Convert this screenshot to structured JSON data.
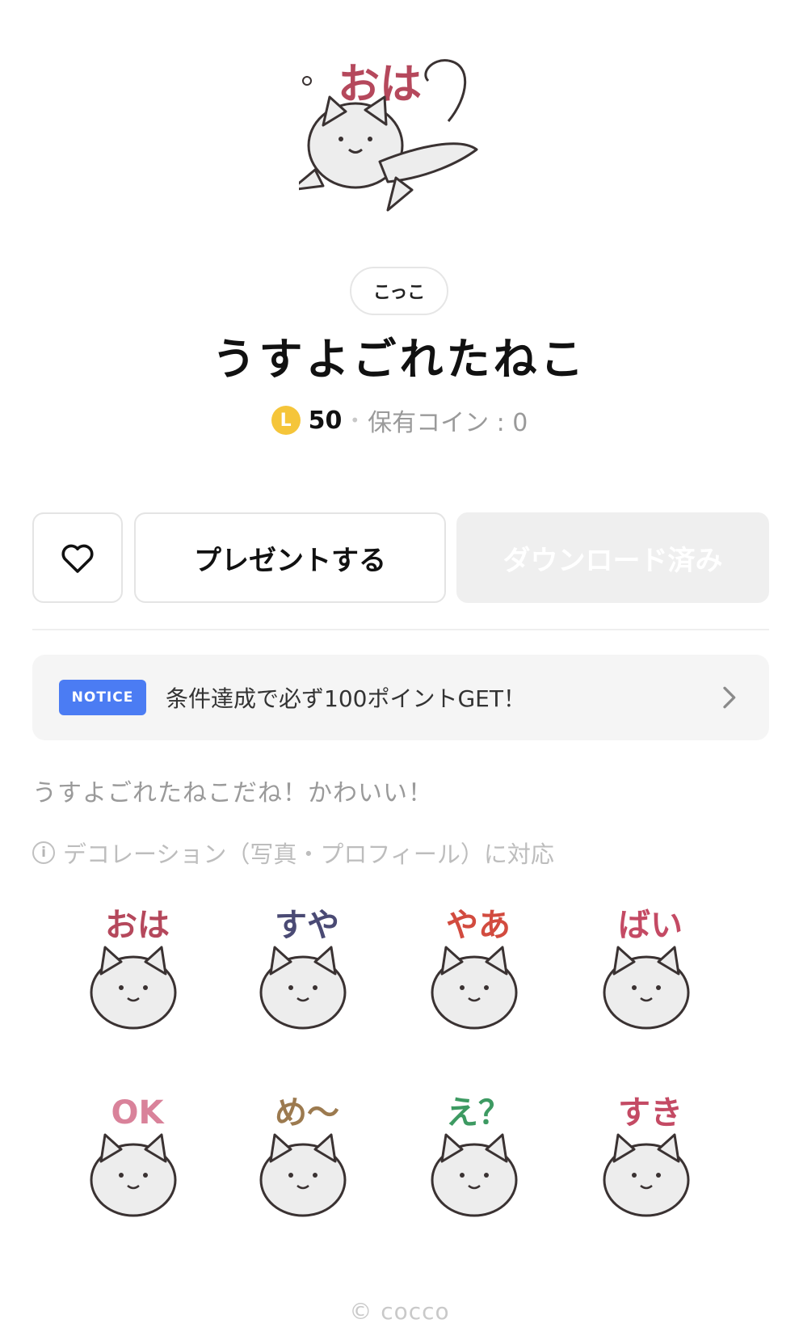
{
  "product": {
    "creator": "こっこ",
    "title": "うすよごれたねこ",
    "coin_symbol": "L",
    "price": "50",
    "separator": "•",
    "owned_coins": "保有コイン : 0",
    "description": "うすよごれたねこだね！かわいい！",
    "decoration_info": "デコレーション（写真・プロフィール）に対応",
    "copyright": "© cocco"
  },
  "actions": {
    "like_icon": "heart-outline-icon",
    "present_label": "プレゼントする",
    "download_label": "ダウンロード済み"
  },
  "notice": {
    "badge": "NOTICE",
    "text": "条件達成で必ず100ポイントGET！",
    "chevron_icon": "chevron-right-icon"
  },
  "hero_sticker": {
    "text": "おは",
    "text_color": "#b5485c"
  },
  "stickers": [
    {
      "text": "おは",
      "color": "#b5485c"
    },
    {
      "text": "すや",
      "color": "#4a4a74"
    },
    {
      "text": "やあ",
      "color": "#d24b3f"
    },
    {
      "text": "ばい",
      "color": "#c44a64"
    },
    {
      "text": "OK",
      "color": "#d9829a"
    },
    {
      "text": "め〜",
      "color": "#9c7a4f"
    },
    {
      "text": "え？",
      "color": "#3d9a62"
    },
    {
      "text": "すき",
      "color": "#c44a64"
    }
  ],
  "colors": {
    "coin": "#f5c53a",
    "notice_badge": "#4b7cf3",
    "download_disabled_bg": "#efefef"
  }
}
